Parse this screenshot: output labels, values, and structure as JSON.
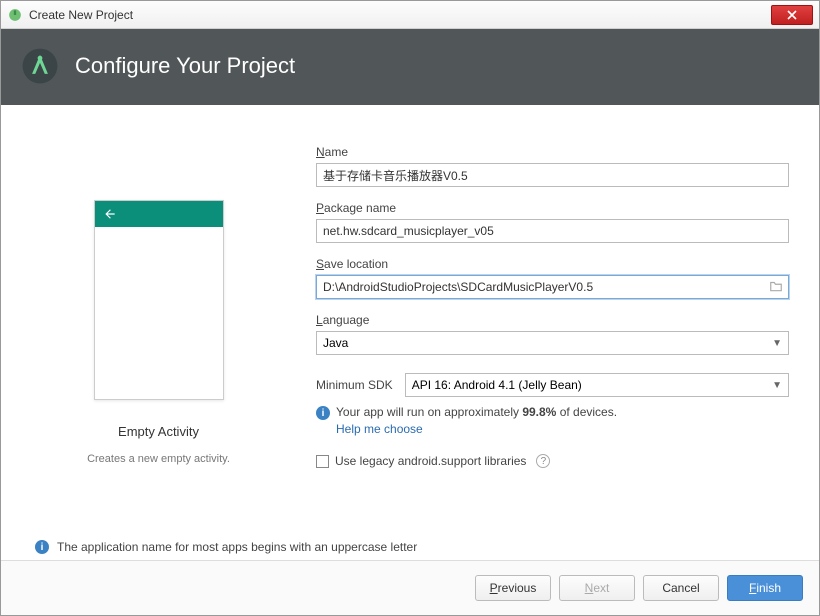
{
  "window": {
    "title": "Create New Project"
  },
  "header": {
    "title": "Configure Your Project"
  },
  "preview": {
    "title": "Empty Activity",
    "description": "Creates a new empty activity."
  },
  "form": {
    "name_label": "Name",
    "name_value": "基于存储卡音乐播放器V0.5",
    "package_label": "Package name",
    "package_value": "net.hw.sdcard_musicplayer_v05",
    "location_label": "Save location",
    "location_value": "D:\\AndroidStudioProjects\\SDCardMusicPlayerV0.5",
    "language_label": "Language",
    "language_value": "Java",
    "sdk_label": "Minimum SDK",
    "sdk_value": "API 16: Android 4.1 (Jelly Bean)",
    "coverage_prefix": "Your app will run on approximately ",
    "coverage_pct": "99.8%",
    "coverage_suffix": " of devices.",
    "help_link": "Help me choose",
    "legacy_label": "Use legacy android.support libraries"
  },
  "bottom_info": "The application name for most apps begins with an uppercase letter",
  "buttons": {
    "previous": "Previous",
    "next": "Next",
    "cancel": "Cancel",
    "finish": "Finish"
  }
}
